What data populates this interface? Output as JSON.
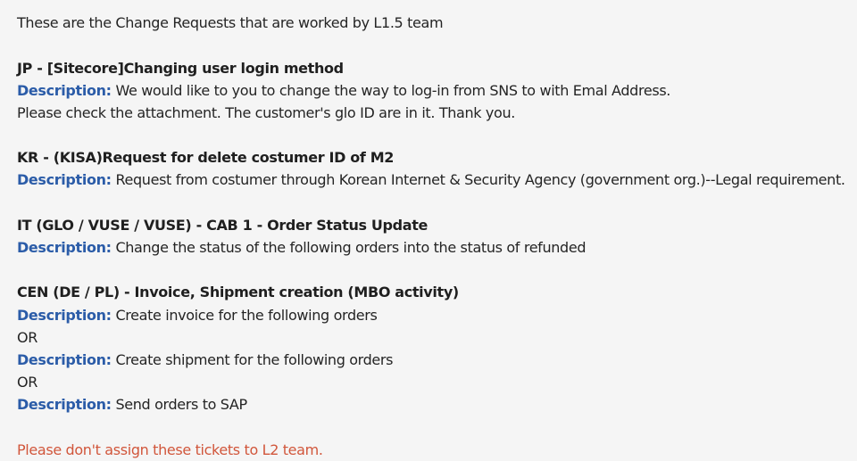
{
  "intro": "These are the Change Requests that are worked by L1.5 team",
  "description_label": "Description:",
  "requests": [
    {
      "title": "JP - [Sitecore]Changing user login method",
      "description": "We would like to you to change the way to log-in from SNS to with Emal Address.",
      "continuation": "Please check the attachment.  The customer's glo ID are in it. Thank you."
    },
    {
      "title": "KR - (KISA)Request for delete costumer ID of M2",
      "description": "Request from costumer through Korean Internet & Security Agency (government org.)--Legal requirement."
    },
    {
      "title": "IT (GLO / VUSE / VUSE) - CAB 1 - Order Status Update",
      "description": "Change the status of the following orders into the status of refunded"
    },
    {
      "title": "CEN (DE / PL) - Invoice, Shipment creation (MBO activity)",
      "descriptions": [
        "Create invoice for the following orders",
        "Create shipment for the following orders",
        "Send orders to SAP"
      ],
      "separator": "OR"
    }
  ],
  "warning": "Please don't assign these tickets to L2 team.",
  "colors": {
    "background": "#f5f5f5",
    "text": "#242424",
    "description_label": "#2b5ca8",
    "warning": "#d1563b"
  }
}
